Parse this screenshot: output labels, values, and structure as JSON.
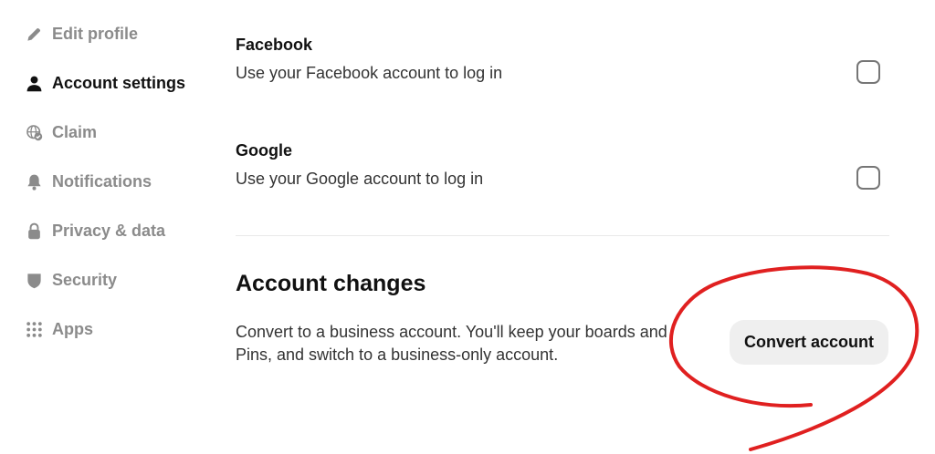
{
  "sidebar": {
    "items": [
      {
        "label": "Edit profile",
        "icon": "pencil-icon",
        "active": false
      },
      {
        "label": "Account settings",
        "icon": "person-icon",
        "active": true
      },
      {
        "label": "Claim",
        "icon": "globe-check-icon",
        "active": false
      },
      {
        "label": "Notifications",
        "icon": "bell-icon",
        "active": false
      },
      {
        "label": "Privacy & data",
        "icon": "lock-icon",
        "active": false
      },
      {
        "label": "Security",
        "icon": "shield-icon",
        "active": false
      },
      {
        "label": "Apps",
        "icon": "grid-dots-icon",
        "active": false
      }
    ]
  },
  "login_options": [
    {
      "title": "Facebook",
      "description": "Use your Facebook account to log in",
      "checked": false
    },
    {
      "title": "Google",
      "description": "Use your Google account to log in",
      "checked": false
    }
  ],
  "account_changes": {
    "title": "Account changes",
    "description": "Convert to a business account. You'll keep your boards and Pins, and switch to a business-only account.",
    "button_label": "Convert account"
  },
  "colors": {
    "annotation": "#e02020",
    "button_bg": "#efefef",
    "active_text": "#111111",
    "inactive_text": "#8b8b8b"
  }
}
